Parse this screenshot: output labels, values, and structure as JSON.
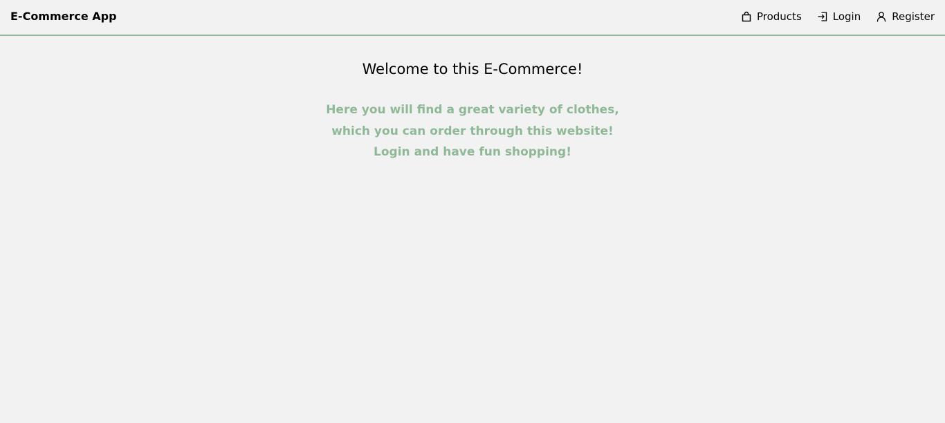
{
  "header": {
    "brand": "E-Commerce App",
    "nav": [
      {
        "label": "Products",
        "icon": "shopping-bag-icon"
      },
      {
        "label": "Login",
        "icon": "login-icon"
      },
      {
        "label": "Register",
        "icon": "user-icon"
      }
    ],
    "accent_color": "#8fb996"
  },
  "main": {
    "title": "Welcome to this E-Commerce!",
    "intro_lines": [
      "Here you will find a great variety of clothes,",
      "which you can order through this website!",
      "Login and have fun shopping!"
    ],
    "intro_color": "#8fb996"
  }
}
